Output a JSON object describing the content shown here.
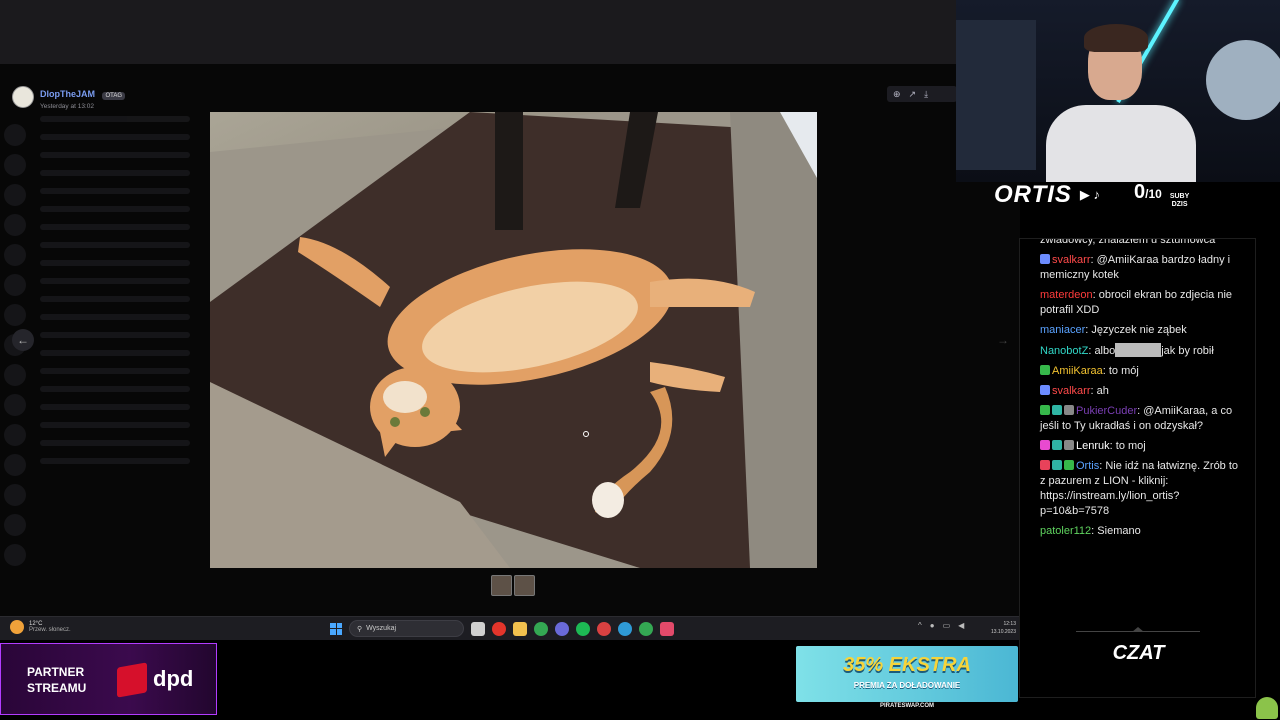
{
  "message": {
    "author_name": "DlopTheJAM",
    "author_tag": "OTAG",
    "timestamp": "Yesterday at 13:02"
  },
  "image_viewer": {
    "tool_icons": [
      "zoom-icon",
      "share-icon",
      "download-icon"
    ]
  },
  "taskbar": {
    "weather_temp": "12°C",
    "weather_desc": "Przew. słonecz.",
    "search_placeholder": "Wyszukaj",
    "time": "12:13",
    "date": "13.10.2023",
    "app_colors": [
      "#d0d0d0",
      "#e3352b",
      "#f2c14e",
      "#34a853",
      "#6a6ad8",
      "#1db954",
      "#d94141",
      "#2f9ad6",
      "#34a853",
      "#e24a6a"
    ]
  },
  "stream": {
    "brand": "ORTIS",
    "subs_count": "0",
    "subs_goal": "/10",
    "subs_label_1": "SUBY",
    "subs_label_2": "DZIS"
  },
  "chat": {
    "messages": [
      {
        "user": "",
        "user_color": "#e8e8e8",
        "text": "zwiadowcy, znalazłem u sztumowca",
        "badges": []
      },
      {
        "user": "svalkarr",
        "user_color": "#ff4a4a",
        "text": "@AmiiKaraa bardzo ładny i memiczny kotek",
        "badges": [
          "#6c8cff"
        ]
      },
      {
        "user": "materdeon",
        "user_color": "#ff3b3b",
        "text": "obrocil ekran bo zdjecia nie potrafil XDD",
        "badges": []
      },
      {
        "user": "maniacer",
        "user_color": "#5aa2ff",
        "text": "Języczek nie ząbek",
        "badges": []
      },
      {
        "user": "NanobotZ",
        "user_color": "#31d8c8",
        "text": "albo",
        "text_after": "jak by robił",
        "badges": []
      },
      {
        "user": "AmiiKaraa",
        "user_color": "#f2c230",
        "text": "to mój",
        "badges": [
          "#36b84a"
        ]
      },
      {
        "user": "svalkarr",
        "user_color": "#ff4a4a",
        "text": "ah",
        "badges": [
          "#6c8cff"
        ]
      },
      {
        "user": "PukierCuder",
        "user_color": "#7b3fb5",
        "text": "@AmiiKaraa, a co jeśli to Ty ukradłaś i on odzyskał?",
        "badges": [
          "#36b84a",
          "#2fb5a5",
          "#888888"
        ]
      },
      {
        "user": "Lenruk",
        "user_color": "#ffffff",
        "text": "to moj",
        "badges": [
          "#e84ad0",
          "#2fb5a5",
          "#888888"
        ]
      },
      {
        "user": "Ortis",
        "user_color": "#5aa2ff",
        "text": "Nie idź na łatwiznę. Zrób to z pazurem z LION - kliknij: https://instream.ly/lion_ortis?p=10&b=7578",
        "badges": [
          "#e8425a",
          "#2fb5a5",
          "#36b84a"
        ]
      },
      {
        "user": "patoler112",
        "user_color": "#5fd35f",
        "text": "Siemano",
        "badges": []
      }
    ],
    "footer_label": "CZAT"
  },
  "sponsors": {
    "partner_line1": "PARTNER",
    "partner_line2": "STREAMU",
    "partner_brand": "dpd",
    "promo_main": "35% EKSTRA",
    "promo_sub": "PREMIA ZA DOŁADOWANIE",
    "promo_url": "PIRATESWAP.COM"
  }
}
